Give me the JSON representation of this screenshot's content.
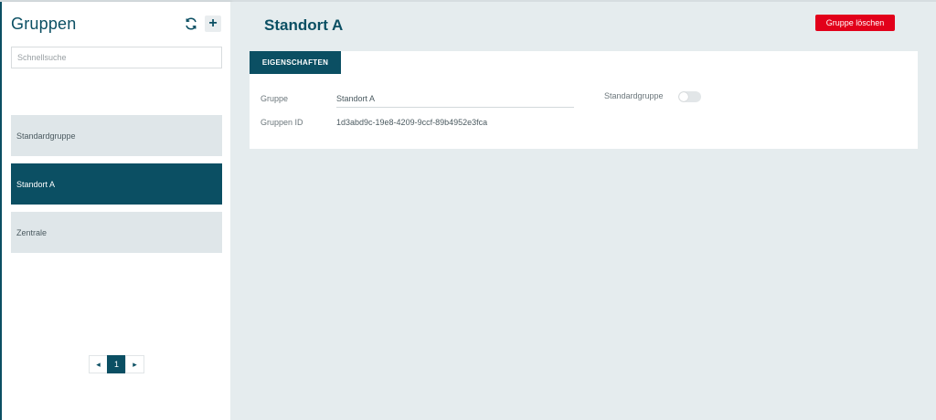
{
  "sidebar": {
    "title": "Gruppen",
    "refresh_icon": "refresh-icon",
    "add_label": "+",
    "search_placeholder": "Schnellsuche",
    "groups": [
      {
        "label": "Standardgruppe",
        "active": false
      },
      {
        "label": "Standort A",
        "active": true
      },
      {
        "label": "Zentrale",
        "active": false
      }
    ],
    "pagination": {
      "prev": "◂",
      "current": "1",
      "next": "▸"
    }
  },
  "main": {
    "title": "Standort A",
    "delete_label": "Gruppe löschen",
    "tab_label": "EIGENSCHAFTEN",
    "fields": {
      "group_label": "Gruppe",
      "group_value": "Standort A",
      "id_label": "Gruppen ID",
      "id_value": "1d3abd9c-19e8-4209-9ccf-89b4952e3fca",
      "default_label": "Standardgruppe",
      "default_on": false
    }
  },
  "colors": {
    "primary": "#0b4f63",
    "danger": "#e2001a",
    "background": "#e5ecee",
    "list_item": "#dfe6e9"
  }
}
